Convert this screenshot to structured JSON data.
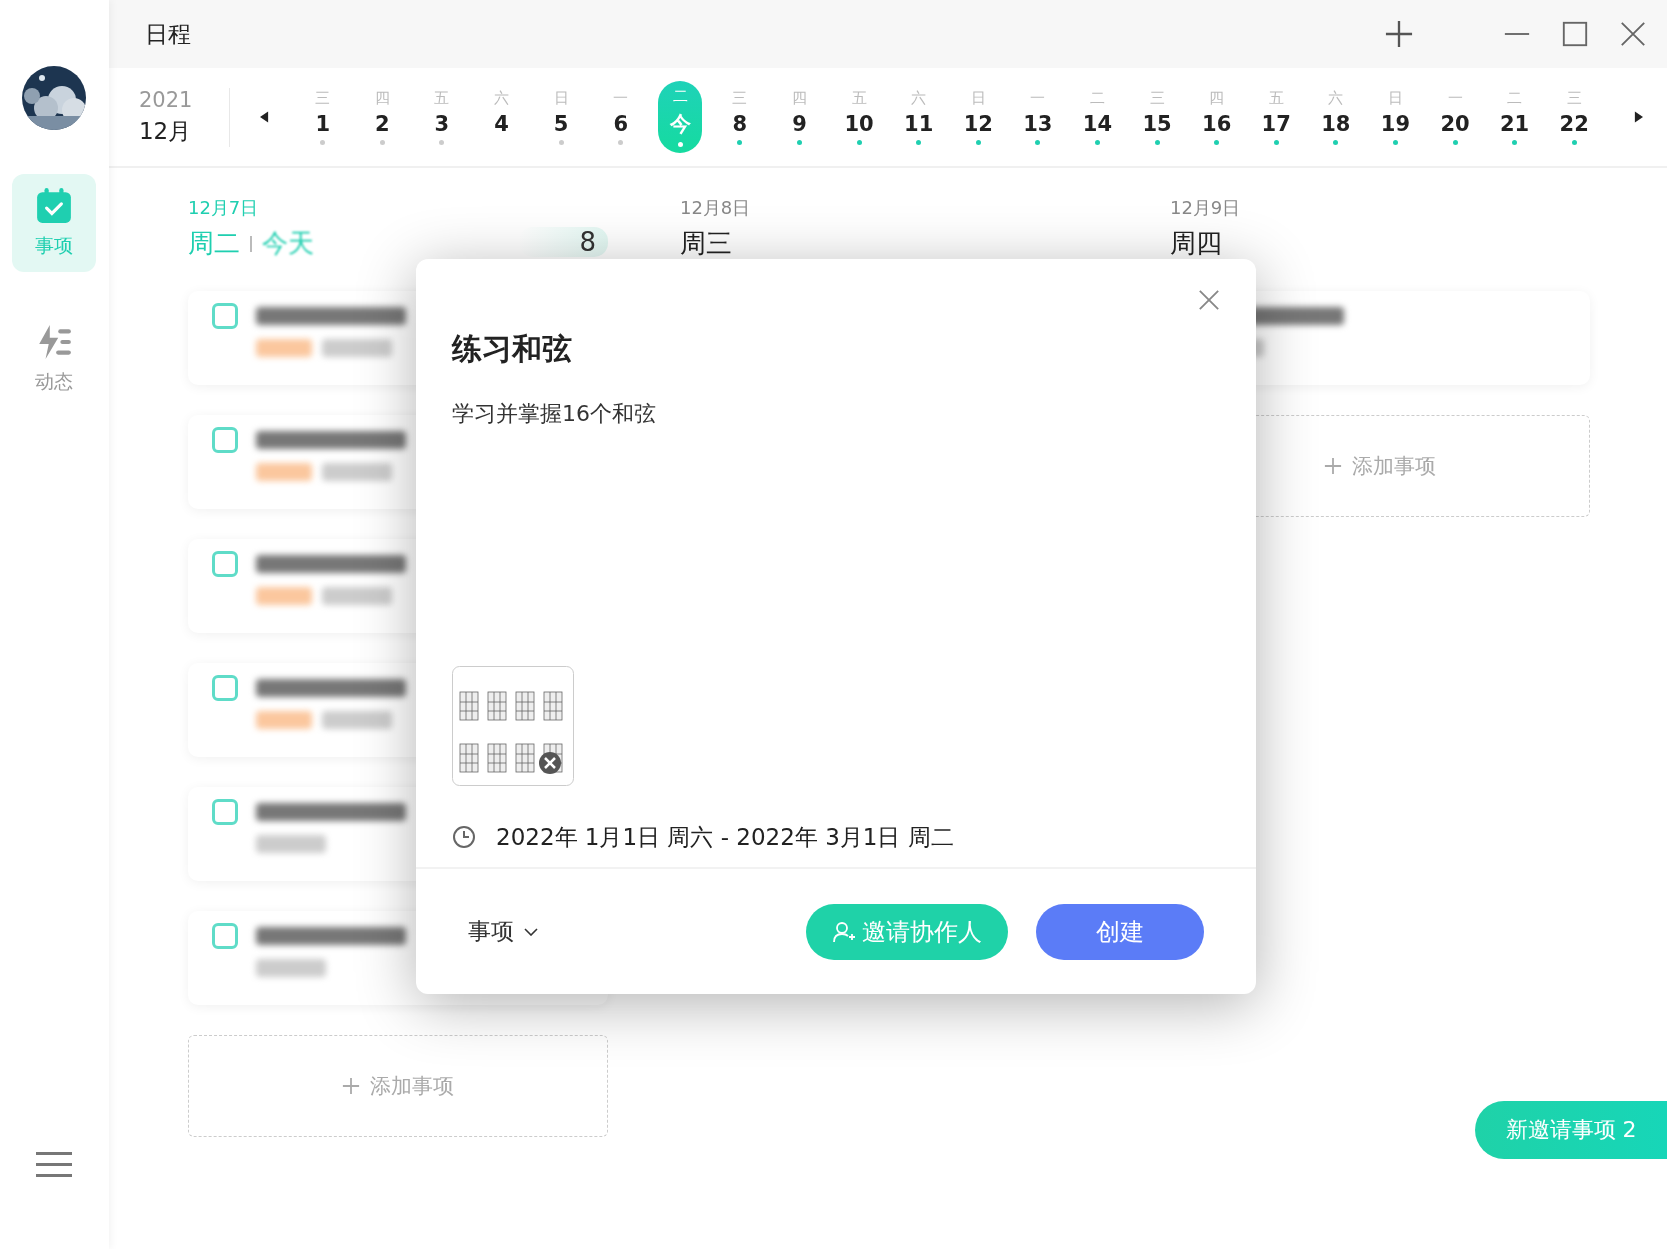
{
  "window": {
    "title": "日程"
  },
  "sidebar": {
    "items": [
      {
        "kind": "calendar",
        "label": "事项",
        "selected": true
      },
      {
        "kind": "activity",
        "label": "动态",
        "selected": false
      }
    ]
  },
  "date_strip": {
    "year": "2021",
    "month": "12月",
    "days": [
      {
        "weekday": "三",
        "day": "1",
        "has_event": true,
        "past": true,
        "selected": false
      },
      {
        "weekday": "四",
        "day": "2",
        "has_event": true,
        "past": true,
        "selected": false
      },
      {
        "weekday": "五",
        "day": "3",
        "has_event": true,
        "past": true,
        "selected": false
      },
      {
        "weekday": "六",
        "day": "4",
        "has_event": false,
        "selected": false
      },
      {
        "weekday": "日",
        "day": "5",
        "has_event": true,
        "past": true,
        "selected": false
      },
      {
        "weekday": "一",
        "day": "6",
        "has_event": true,
        "past": true,
        "selected": false
      },
      {
        "weekday": "二",
        "day": "今",
        "has_event": true,
        "selected": true
      },
      {
        "weekday": "三",
        "day": "8",
        "has_event": true,
        "past": false,
        "selected": false
      },
      {
        "weekday": "四",
        "day": "9",
        "has_event": true,
        "past": false,
        "selected": false
      },
      {
        "weekday": "五",
        "day": "10",
        "has_event": true,
        "past": false,
        "selected": false
      },
      {
        "weekday": "六",
        "day": "11",
        "has_event": true,
        "past": false,
        "selected": false
      },
      {
        "weekday": "日",
        "day": "12",
        "has_event": true,
        "past": false,
        "selected": false
      },
      {
        "weekday": "一",
        "day": "13",
        "has_event": true,
        "past": false,
        "selected": false
      },
      {
        "weekday": "二",
        "day": "14",
        "has_event": true,
        "past": false,
        "selected": false
      },
      {
        "weekday": "三",
        "day": "15",
        "has_event": true,
        "past": false,
        "selected": false
      },
      {
        "weekday": "四",
        "day": "16",
        "has_event": true,
        "past": false,
        "selected": false
      },
      {
        "weekday": "五",
        "day": "17",
        "has_event": true,
        "past": false,
        "selected": false
      },
      {
        "weekday": "六",
        "day": "18",
        "has_event": true,
        "past": false,
        "selected": false
      },
      {
        "weekday": "日",
        "day": "19",
        "has_event": true,
        "past": false,
        "selected": false
      },
      {
        "weekday": "一",
        "day": "20",
        "has_event": true,
        "past": false,
        "selected": false
      },
      {
        "weekday": "二",
        "day": "21",
        "has_event": true,
        "past": false,
        "selected": false
      },
      {
        "weekday": "三",
        "day": "22",
        "has_event": true,
        "past": false,
        "selected": false
      }
    ]
  },
  "columns": [
    {
      "date": "12月7日",
      "weekday": "周二",
      "today_label": "今天",
      "done_count": "8",
      "tasks": [
        {
          "checked": false,
          "tagged": true
        },
        {
          "checked": false,
          "tagged": true
        },
        {
          "checked": false,
          "tagged": true
        },
        {
          "checked": false,
          "tagged": true
        },
        {
          "checked": false,
          "tagged": false
        },
        {
          "checked": false,
          "tagged": false
        }
      ],
      "add_label": "添加事项"
    },
    {
      "date": "12月8日",
      "weekday": "周三"
    },
    {
      "date": "12月9日",
      "weekday": "周四",
      "tasks": [
        {
          "tagged": false
        }
      ],
      "add_label": "添加事项"
    }
  ],
  "dialog": {
    "title": "练习和弦",
    "description": "学习并掌握16个和弦",
    "date_range": "2022年 1月1日 周六 - 2022年 3月1日 周二",
    "type_label": "事项",
    "invite_button": "邀请协作人",
    "create_button": "创建"
  },
  "invite_badge": "新邀请事项 2"
}
